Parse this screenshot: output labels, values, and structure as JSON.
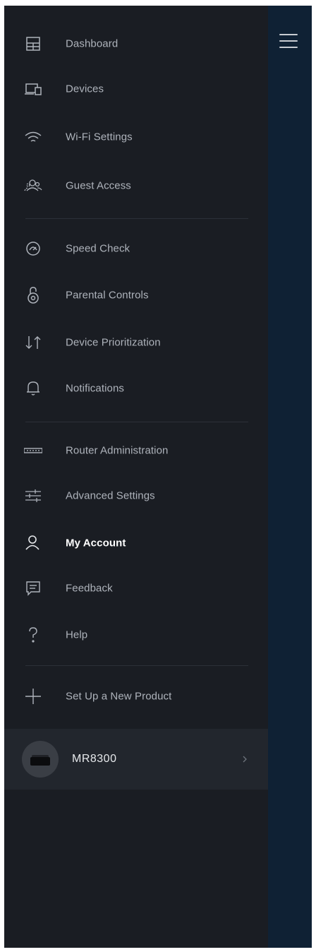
{
  "menu": {
    "items": [
      {
        "label": "Dashboard",
        "icon": "dashboard-icon"
      },
      {
        "label": "Devices",
        "icon": "devices-icon"
      },
      {
        "label": "Wi-Fi Settings",
        "icon": "wifi-icon"
      },
      {
        "label": "Guest Access",
        "icon": "guest-access-icon"
      },
      {
        "label": "Speed Check",
        "icon": "speed-check-icon"
      },
      {
        "label": "Parental Controls",
        "icon": "parental-controls-icon"
      },
      {
        "label": "Device Prioritization",
        "icon": "device-prioritization-icon"
      },
      {
        "label": "Notifications",
        "icon": "bell-icon"
      },
      {
        "label": "Router Administration",
        "icon": "router-icon"
      },
      {
        "label": "Advanced Settings",
        "icon": "sliders-icon"
      },
      {
        "label": "My Account",
        "icon": "account-icon",
        "active": true
      },
      {
        "label": "Feedback",
        "icon": "feedback-icon"
      },
      {
        "label": "Help",
        "icon": "help-icon"
      },
      {
        "label": "Set Up a New Product",
        "icon": "plus-icon"
      }
    ]
  },
  "product": {
    "name": "MR8300",
    "icon": "router-image"
  },
  "colors": {
    "drawer_bg": "#1a1d23",
    "background_panel": "#0f2134",
    "label": "#aeb3bb",
    "active_label": "#ffffff"
  }
}
